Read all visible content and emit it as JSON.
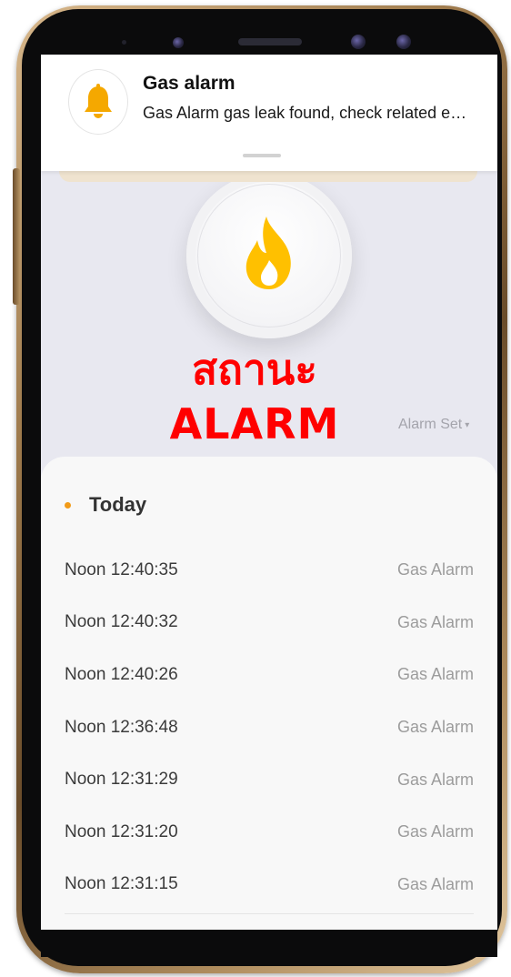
{
  "notification": {
    "title": "Gas alarm",
    "body": "Gas Alarm  gas leak found, check related e…",
    "icon": "bell-icon",
    "icon_color": "#f5a800"
  },
  "status": {
    "icon": "flame-icon",
    "flame_color": "#ffc000",
    "line1": "สถานะ",
    "line2": "ALARM",
    "text_color": "#ff0000"
  },
  "alarm_set": {
    "label": "Alarm Set",
    "caret": "▾"
  },
  "log": {
    "section_label": "Today",
    "dot_color": "#f29b18",
    "entries": [
      {
        "time": "Noon  12:40:35",
        "type": "Gas Alarm"
      },
      {
        "time": "Noon  12:40:32",
        "type": "Gas Alarm"
      },
      {
        "time": "Noon  12:40:26",
        "type": "Gas Alarm"
      },
      {
        "time": "Noon  12:36:48",
        "type": "Gas Alarm"
      },
      {
        "time": "Noon  12:31:29",
        "type": "Gas Alarm"
      },
      {
        "time": "Noon  12:31:20",
        "type": "Gas Alarm"
      },
      {
        "time": "Noon  12:31:15",
        "type": "Gas Alarm"
      }
    ]
  }
}
